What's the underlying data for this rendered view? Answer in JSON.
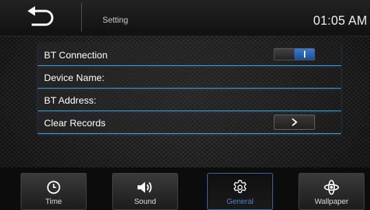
{
  "header": {
    "title": "Setting",
    "time": "01:05 AM"
  },
  "settings": [
    {
      "label": "BT Connection",
      "control": "toggle",
      "state": "on"
    },
    {
      "label": "Device Name:",
      "control": "none"
    },
    {
      "label": "BT Address:",
      "control": "none"
    },
    {
      "label": "Clear Records",
      "control": "arrow"
    }
  ],
  "tabs": [
    {
      "label": "Time",
      "icon": "clock-icon"
    },
    {
      "label": "Sound",
      "icon": "speaker-icon"
    },
    {
      "label": "General",
      "icon": "gear-icon",
      "active": true
    },
    {
      "label": "Wallpaper",
      "icon": "wallpaper-icon"
    }
  ],
  "colors": {
    "accent": "#4aa3d8",
    "active_tab_text": "#4a86cf",
    "toggle_on": "#2a64b5"
  }
}
